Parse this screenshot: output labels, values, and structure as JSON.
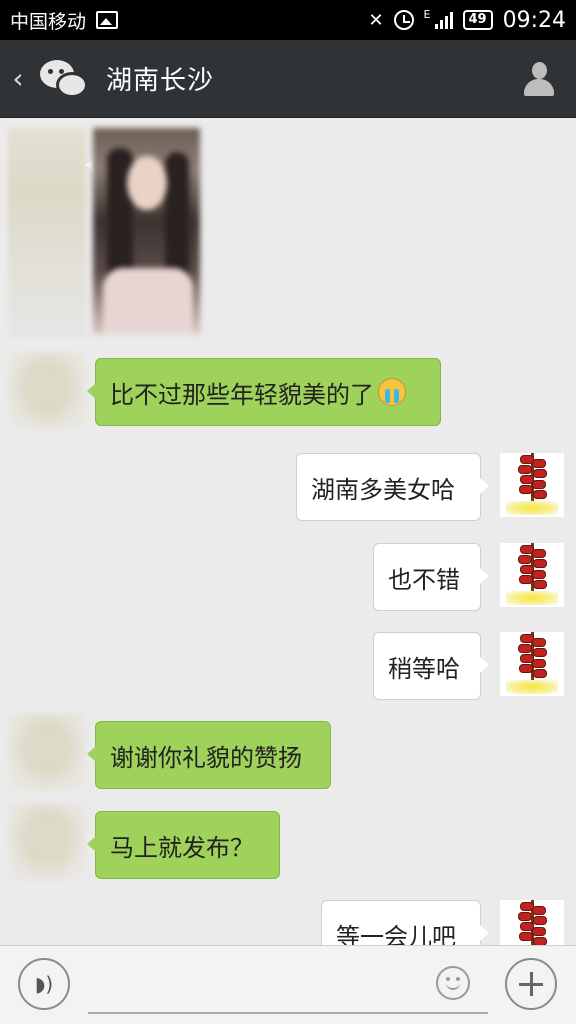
{
  "status_bar": {
    "carrier": "中国移动",
    "network": "E",
    "battery": "49",
    "time": "09:24"
  },
  "header": {
    "back_icon": "chevron-left-icon",
    "app_icon": "wechat-icon",
    "title": "湖南长沙",
    "contact_icon": "person-icon"
  },
  "messages": [
    {
      "side": "left",
      "type": "image"
    },
    {
      "side": "left",
      "type": "text",
      "text": "比不过那些年轻貌美的了",
      "emoji": "crying-emoji"
    },
    {
      "side": "right",
      "type": "text",
      "text": "湖南多美女哈"
    },
    {
      "side": "right",
      "type": "text",
      "text": "也不错"
    },
    {
      "side": "right",
      "type": "text",
      "text": "稍等哈"
    },
    {
      "side": "left",
      "type": "text",
      "text": "谢谢你礼貌的赞扬"
    },
    {
      "side": "left",
      "type": "text",
      "text": "马上就发布？"
    },
    {
      "side": "right",
      "type": "text",
      "text": "等一会儿吧"
    }
  ],
  "input_bar": {
    "voice_icon": "voice-icon",
    "emoji_icon": "smiley-icon",
    "more_icon": "plus-icon"
  },
  "colors": {
    "status_bg": "#000000",
    "header_bg": "#2f3336",
    "chat_bg": "#ebebeb",
    "sent_bubble": "#9ed25a",
    "received_bubble": "#ffffff"
  }
}
